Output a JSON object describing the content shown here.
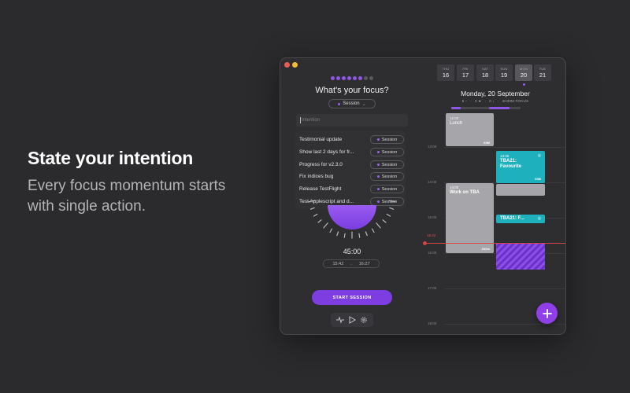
{
  "hero": {
    "title": "State your intention",
    "subtitle": "Every focus momentum starts with single action."
  },
  "focus_panel": {
    "progress": {
      "filled": 6,
      "total": 8
    },
    "title": "What's your focus?",
    "session_selector": "Session",
    "intention_placeholder": "Intention",
    "tasks": [
      {
        "label": "Testimonial update",
        "tag": "Session"
      },
      {
        "label": "Show last 2 days for fr...",
        "tag": "Session"
      },
      {
        "label": "Progress for v2.3.0",
        "tag": "Session"
      },
      {
        "label": "Fix indices bug",
        "tag": "Session"
      },
      {
        "label": "Release TestFlight",
        "tag": "Session"
      },
      {
        "label": "Test Applescript and d...",
        "tag": "Session"
      }
    ],
    "timer": "45:00",
    "start_time": "15:42",
    "end_time": "16:27",
    "arrow": "→",
    "start_button": "START SESSION",
    "icons": [
      "pulse-icon",
      "play-icon",
      "gear-icon"
    ]
  },
  "calendar": {
    "days": [
      {
        "name": "THU",
        "num": "16"
      },
      {
        "name": "FRI",
        "num": "17"
      },
      {
        "name": "SAT",
        "num": "18"
      },
      {
        "name": "SUN",
        "num": "19"
      },
      {
        "name": "MON",
        "num": "20",
        "selected": true
      },
      {
        "name": "TUE",
        "num": "21"
      }
    ],
    "date_title": "Monday, 20 September",
    "stats": [
      "5 ↑",
      "·",
      "0 ★",
      "·",
      "0 ↓",
      "·",
      "4H30M FOCUS"
    ],
    "hours": [
      "13:00",
      "14:00",
      "15:00",
      "16:00",
      "17:00",
      "18:00"
    ],
    "now_time": "15:42",
    "events": [
      {
        "title": "Lunch",
        "time": "12:00",
        "duration": "60M"
      },
      {
        "title": "TBA21: Favourite",
        "time": "13:35",
        "duration": "54M"
      },
      {
        "title": "Work on TBA",
        "time": "14:00",
        "duration": "2h0m"
      },
      {
        "title": "TBA21: F...",
        "duration": ""
      }
    ],
    "colors": {
      "accent": "#8f57e8",
      "teal": "#1fb0bd",
      "now": "#d64545"
    }
  }
}
